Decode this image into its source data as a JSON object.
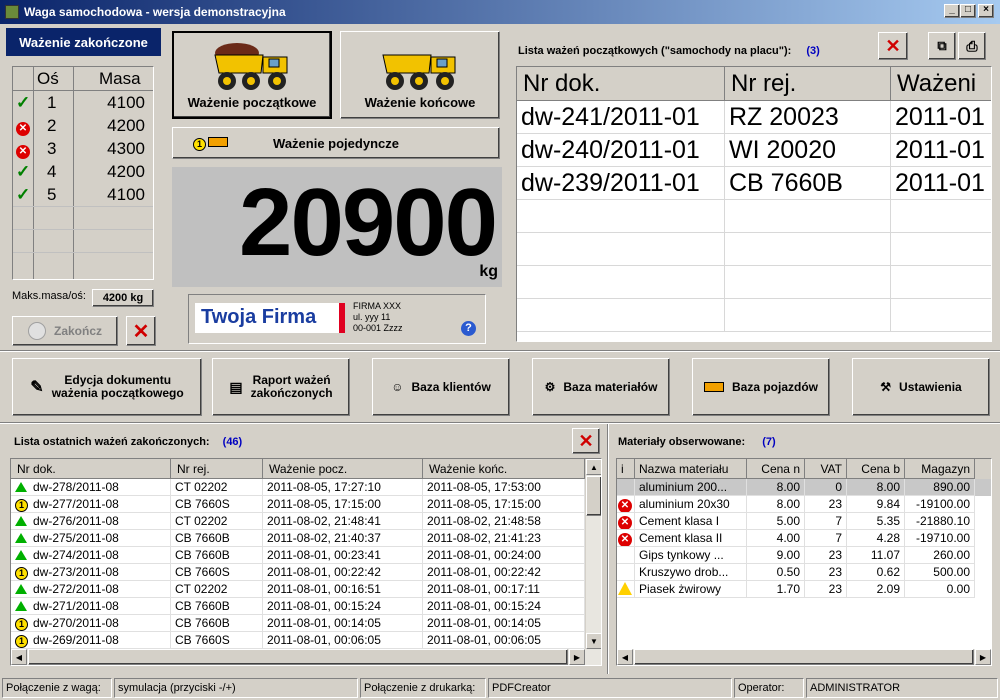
{
  "window": {
    "title": "Waga samochodowa - wersja demonstracyjna"
  },
  "axle_panel": {
    "status": "Ważenie zakończone",
    "col_axle": "Oś",
    "col_mass": "Masa",
    "rows": [
      {
        "status": "ok",
        "axle": "1",
        "mass": "4100"
      },
      {
        "status": "error",
        "axle": "2",
        "mass": "4200"
      },
      {
        "status": "error",
        "axle": "3",
        "mass": "4300"
      },
      {
        "status": "ok",
        "axle": "4",
        "mass": "4200"
      },
      {
        "status": "ok",
        "axle": "5",
        "mass": "4100"
      }
    ],
    "max_label": "Maks.masa/oś:",
    "max_value": "4200 kg",
    "finish_label": "Zakończ"
  },
  "weighing": {
    "initial_label": "Ważenie początkowe",
    "final_label": "Ważenie końcowe",
    "single_label": "Ważenie pojedyncze",
    "display_value": "20900",
    "unit": "kg"
  },
  "company": {
    "logo_text": "Twoja Firma",
    "line1": "FIRMA XXX",
    "line2": "ul. yyy 11",
    "line3": "00-001 Zzzz"
  },
  "initial_list": {
    "title": "Lista ważeń początkowych (\"samochody na placu\"):",
    "count": "(3)",
    "columns": [
      "Nr dok.",
      "Nr rej.",
      "Ważeni"
    ],
    "rows": [
      [
        "dw-241/2011-01",
        "RZ 20023",
        "2011-01"
      ],
      [
        "dw-240/2011-01",
        "WI 20020",
        "2011-01"
      ],
      [
        "dw-239/2011-01",
        "CB 7660B",
        "2011-01"
      ]
    ]
  },
  "toolbar": {
    "edit_doc": [
      "Edycja dokumentu",
      "ważenia początkowego"
    ],
    "report": [
      "Raport ważeń",
      "zakończonych"
    ],
    "clients": "Baza klientów",
    "materials": "Baza materiałów",
    "vehicles": "Baza pojazdów",
    "settings": "Ustawienia"
  },
  "finished_list": {
    "title": "Lista ostatnich ważeń zakończonych:",
    "count": "(46)",
    "columns": [
      "Nr dok.",
      "Nr rej.",
      "Ważenie pocz.",
      "Ważenie końc."
    ],
    "rows": [
      {
        "icon": "up",
        "doc": "dw-278/2011-08",
        "reg": "CT 02202",
        "start": "2011-08-05, 17:27:10",
        "end": "2011-08-05, 17:53:00"
      },
      {
        "icon": "one",
        "doc": "dw-277/2011-08",
        "reg": "CB 7660S",
        "start": "2011-08-05, 17:15:00",
        "end": "2011-08-05, 17:15:00"
      },
      {
        "icon": "up",
        "doc": "dw-276/2011-08",
        "reg": "CT 02202",
        "start": "2011-08-02, 21:48:41",
        "end": "2011-08-02, 21:48:58"
      },
      {
        "icon": "up",
        "doc": "dw-275/2011-08",
        "reg": "CB 7660B",
        "start": "2011-08-02, 21:40:37",
        "end": "2011-08-02, 21:41:23"
      },
      {
        "icon": "up",
        "doc": "dw-274/2011-08",
        "reg": "CB 7660B",
        "start": "2011-08-01, 00:23:41",
        "end": "2011-08-01, 00:24:00"
      },
      {
        "icon": "one",
        "doc": "dw-273/2011-08",
        "reg": "CB 7660S",
        "start": "2011-08-01, 00:22:42",
        "end": "2011-08-01, 00:22:42"
      },
      {
        "icon": "up",
        "doc": "dw-272/2011-08",
        "reg": "CT 02202",
        "start": "2011-08-01, 00:16:51",
        "end": "2011-08-01, 00:17:11"
      },
      {
        "icon": "up",
        "doc": "dw-271/2011-08",
        "reg": "CB 7660B",
        "start": "2011-08-01, 00:15:24",
        "end": "2011-08-01, 00:15:24"
      },
      {
        "icon": "one",
        "doc": "dw-270/2011-08",
        "reg": "CB 7660B",
        "start": "2011-08-01, 00:14:05",
        "end": "2011-08-01, 00:14:05"
      },
      {
        "icon": "one",
        "doc": "dw-269/2011-08",
        "reg": "CB 7660S",
        "start": "2011-08-01, 00:06:05",
        "end": "2011-08-01, 00:06:05"
      }
    ]
  },
  "materials": {
    "title": "Materiały obserwowane:",
    "count": "(7)",
    "columns": [
      "i",
      "Nazwa materiału",
      "Cena n",
      "VAT",
      "Cena b",
      "Magazyn"
    ],
    "rows": [
      {
        "icon": "",
        "name": "aluminium 200...",
        "net": "8.00",
        "vat": "0",
        "gross": "8.00",
        "stock": "890.00"
      },
      {
        "icon": "error",
        "name": "aluminium 20x30",
        "net": "8.00",
        "vat": "23",
        "gross": "9.84",
        "stock": "-19100.00"
      },
      {
        "icon": "error",
        "name": "Cement klasa I",
        "net": "5.00",
        "vat": "7",
        "gross": "5.35",
        "stock": "-21880.10"
      },
      {
        "icon": "error",
        "name": "Cement klasa II",
        "net": "4.00",
        "vat": "7",
        "gross": "4.28",
        "stock": "-19710.00"
      },
      {
        "icon": "",
        "name": "Gips tynkowy ...",
        "net": "9.00",
        "vat": "23",
        "gross": "11.07",
        "stock": "260.00"
      },
      {
        "icon": "",
        "name": "Kruszywo drob...",
        "net": "0.50",
        "vat": "23",
        "gross": "0.62",
        "stock": "500.00"
      },
      {
        "icon": "warning",
        "name": "Piasek żwirowy",
        "net": "1.70",
        "vat": "23",
        "gross": "2.09",
        "stock": "0.00"
      }
    ]
  },
  "statusbar": {
    "conn_scale_label": "Połączenie z wagą:",
    "conn_scale_value": "symulacja (przyciski -/+)",
    "conn_printer_label": "Połączenie z drukarką:",
    "conn_printer_value": "PDFCreator",
    "operator_label": "Operator:",
    "operator_value": "ADMINISTRATOR"
  }
}
